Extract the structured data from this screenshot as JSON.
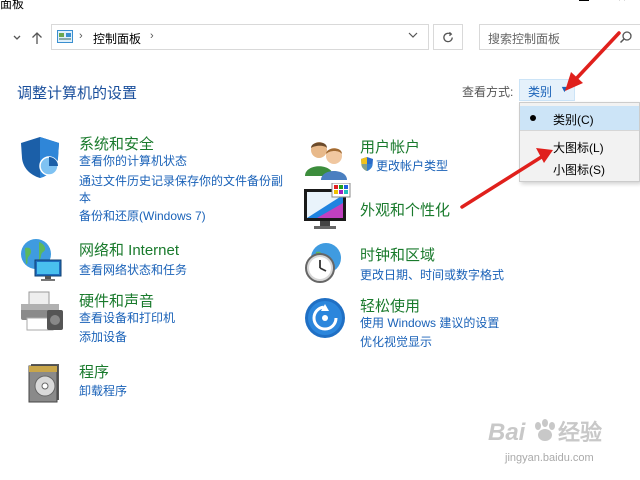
{
  "window": {
    "title": "面板"
  },
  "address": {
    "path": "控制面板"
  },
  "search": {
    "placeholder": "搜索控制面板"
  },
  "page": {
    "title": "调整计算机的设置"
  },
  "view": {
    "label": "查看方式:",
    "selected": "类别",
    "options": [
      {
        "label": "类别(C)",
        "selected": true
      },
      {
        "label": "大图标(L)",
        "selected": false
      },
      {
        "label": "小图标(S)",
        "selected": false
      }
    ]
  },
  "categories": {
    "system": {
      "title": "系统和安全",
      "links": [
        "查看你的计算机状态",
        "通过文件历史记录保存你的文件备份副",
        "本",
        "备份和还原(Windows 7)"
      ]
    },
    "network": {
      "title": "网络和 Internet",
      "links": [
        "查看网络状态和任务"
      ]
    },
    "hardware": {
      "title": "硬件和声音",
      "links": [
        "查看设备和打印机",
        "添加设备"
      ]
    },
    "programs": {
      "title": "程序",
      "links": [
        "卸载程序"
      ]
    },
    "user": {
      "title": "用户帐户",
      "links": [
        "更改帐户类型"
      ]
    },
    "appearance": {
      "title": "外观和个性化"
    },
    "clock": {
      "title": "时钟和区域",
      "links": [
        "更改日期、时间或数字格式"
      ]
    },
    "ease": {
      "title": "轻松使用",
      "links": [
        "使用 Windows 建议的设置",
        "优化视觉显示"
      ]
    }
  },
  "watermark": {
    "brand": "Baidu",
    "label": "经验",
    "url": "jingyan.baidu.com"
  },
  "colors": {
    "link": "#1a62b8",
    "category": "#197a2c",
    "heading": "#1a4f9c",
    "annotation": "#e0201c"
  }
}
